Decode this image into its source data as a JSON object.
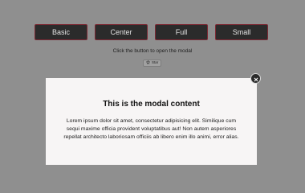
{
  "toolbar": {
    "buttons": [
      {
        "label": "Basic"
      },
      {
        "label": "Center"
      },
      {
        "label": "Full"
      },
      {
        "label": "Small"
      }
    ]
  },
  "prompt": {
    "text": "Click the button to open the modal"
  },
  "star_button": {
    "label": "Star",
    "icon": "star-icon"
  },
  "modal": {
    "title": "This is the modal content",
    "body": "Lorem ipsum dolor sit amet, consectetur adipisicing elit. Similique cum sequi maxime officia provident voluptatibus aut! Non autem asperiores repellat architecto laboriosam officiis ab libero enim illo animi, error alias.",
    "close_icon": "close-icon"
  },
  "colors": {
    "overlay": "#8f8f8f",
    "button_background": "#2b2b2b",
    "button_border": "#7c2a34",
    "button_text": "#e3e3e3",
    "modal_background": "#f7f5f5",
    "close_background": "#2a2a2a"
  }
}
